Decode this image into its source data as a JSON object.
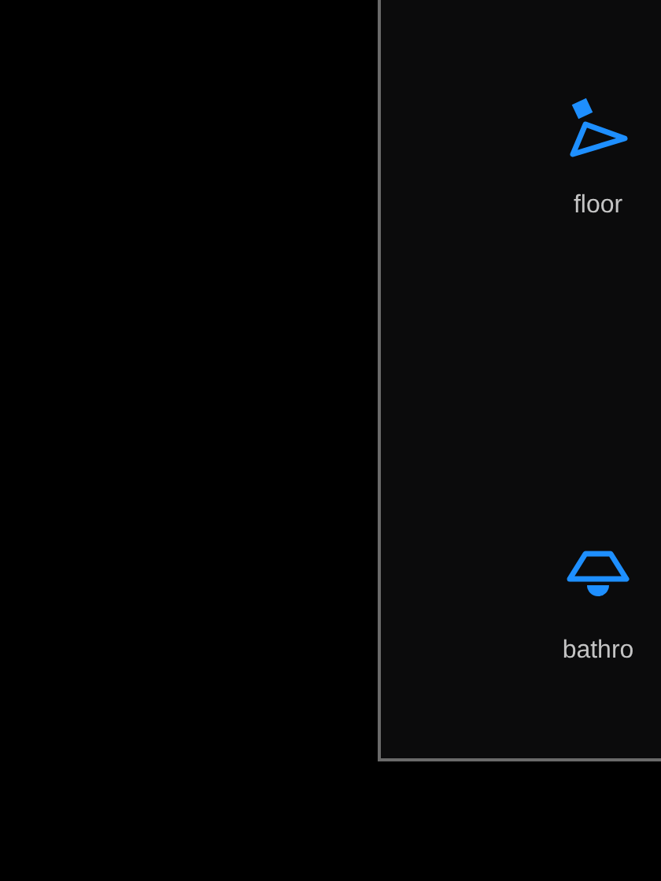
{
  "tiles": [
    {
      "kind": "floor_lamp",
      "label": "floor"
    },
    {
      "kind": "ceiling_lamp",
      "label": "bathro"
    }
  ]
}
